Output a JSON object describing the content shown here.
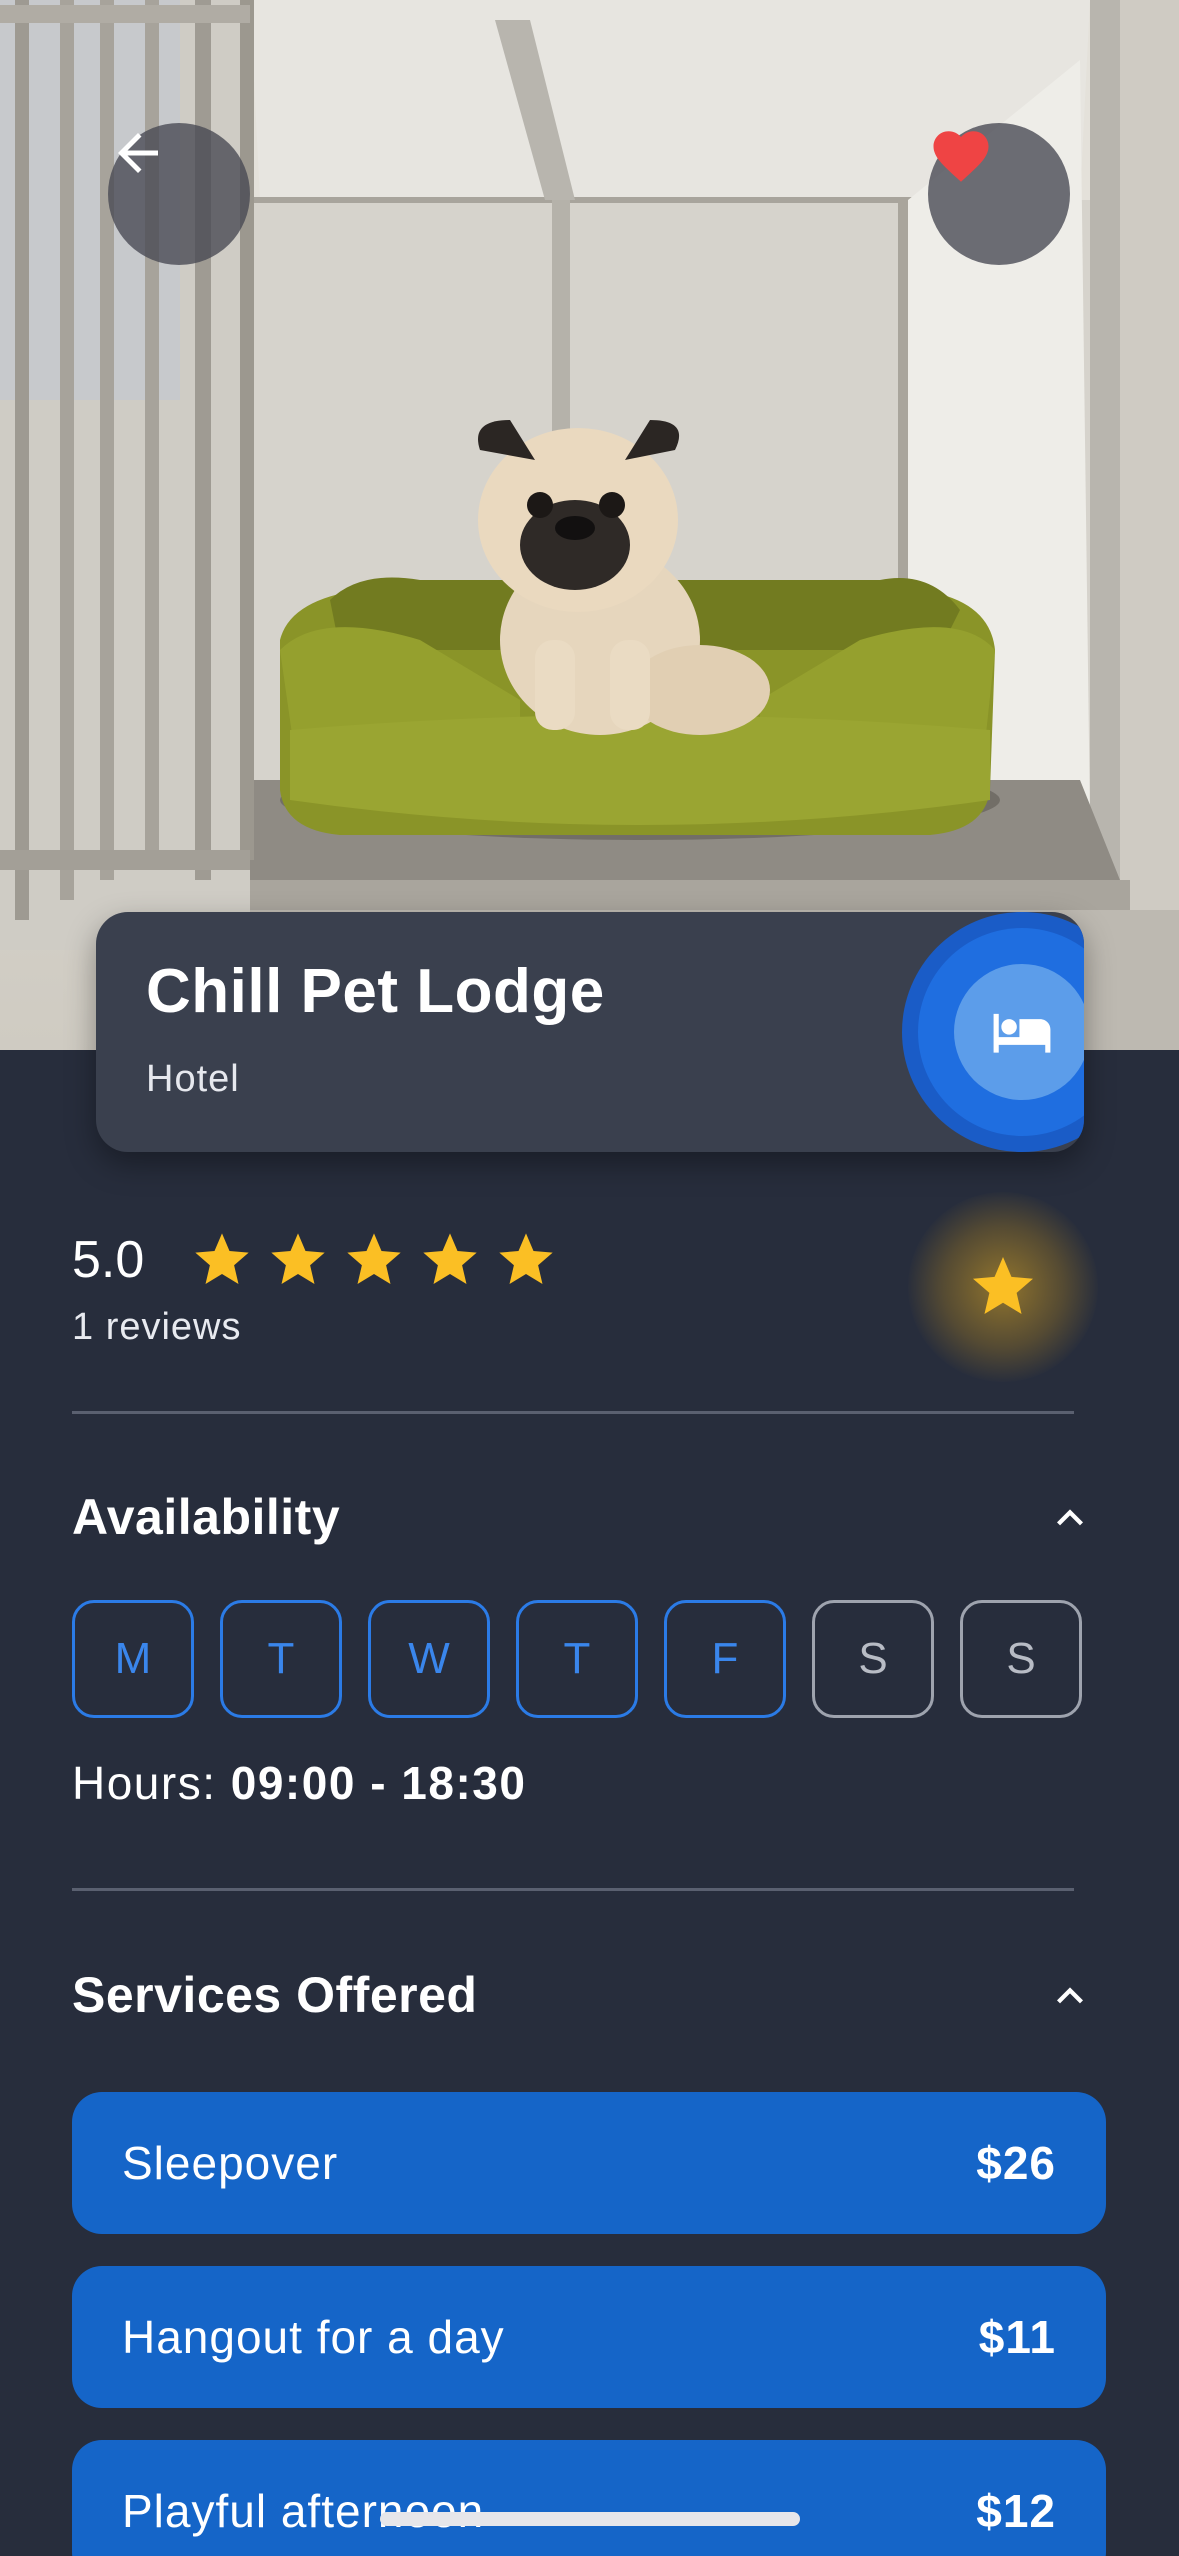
{
  "hero": {
    "image_alt": "Pug sitting in a green dog bed inside a kennel",
    "back_icon": "arrow-left-icon",
    "favorite_icon": "heart-icon"
  },
  "listing": {
    "name": "Chill Pet Lodge",
    "category": "Hotel",
    "category_icon": "bed-icon"
  },
  "rating": {
    "value": "5.0",
    "stars": 5,
    "reviews": "1  reviews",
    "rate_icon": "star-icon"
  },
  "availability": {
    "title": "Availability",
    "days": [
      {
        "label": "M",
        "available": true
      },
      {
        "label": "T",
        "available": true
      },
      {
        "label": "W",
        "available": true
      },
      {
        "label": "T",
        "available": true
      },
      {
        "label": "F",
        "available": true
      },
      {
        "label": "S",
        "available": false
      },
      {
        "label": "S",
        "available": false
      }
    ],
    "hours_label": "Hours: ",
    "hours_value": "09:00 - 18:30"
  },
  "services": {
    "title": "Services Offered",
    "items": [
      {
        "label": "Sleepover",
        "price": "$26"
      },
      {
        "label": "Hangout for a day",
        "price": "$11"
      },
      {
        "label": "Playful afternoon",
        "price": "$12"
      }
    ]
  },
  "colors": {
    "background": "#272d3c",
    "card": "#3a404e",
    "accent_blue": "#1565c8",
    "day_available": "#2b7be6",
    "star": "#fbbf24",
    "heart": "#ef4444"
  }
}
